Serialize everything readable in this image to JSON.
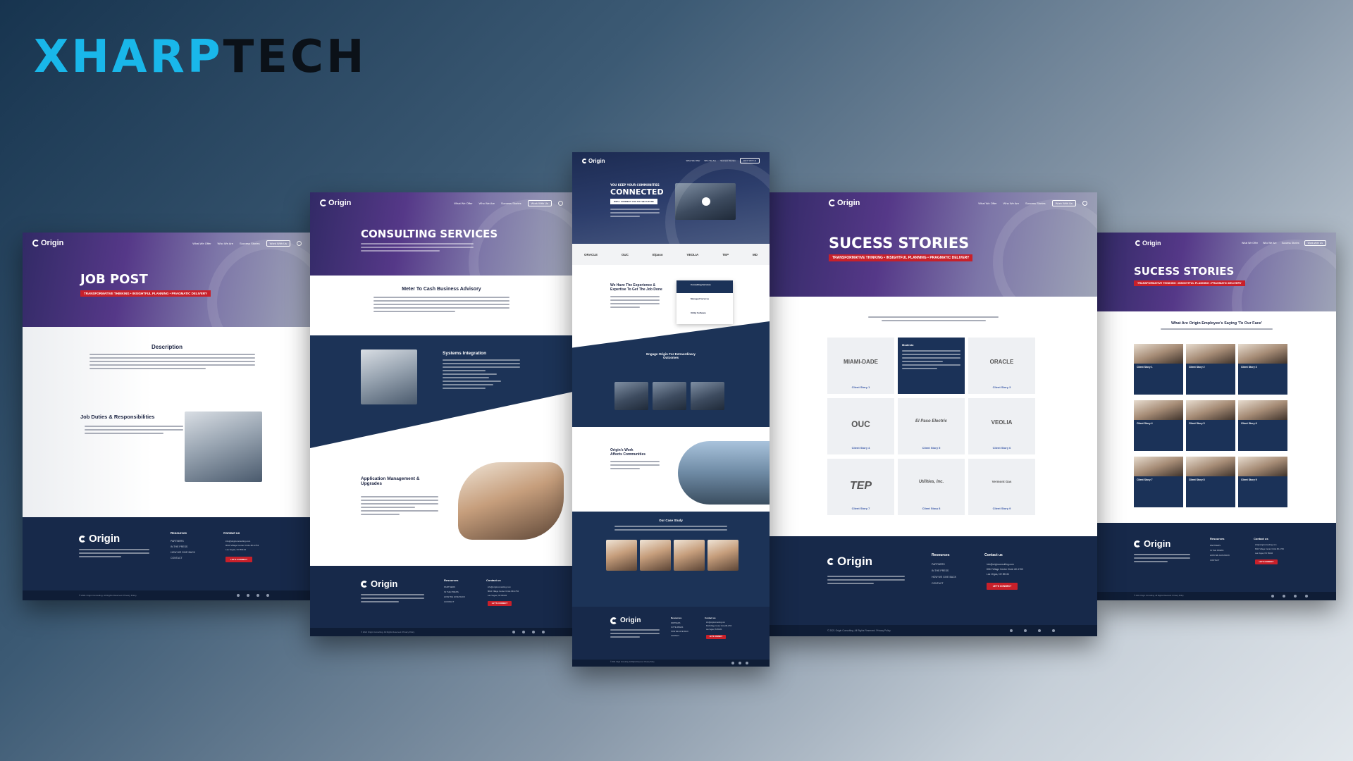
{
  "brand": {
    "part1": "XHARP",
    "part2": "TECH"
  },
  "site": {
    "logo": "Origin",
    "nav": [
      "What We Offer",
      "Who We Are",
      "Success Stories",
      "Work With Us"
    ],
    "footer": {
      "resources_heading": "Resources",
      "resources": [
        "PARTNERS",
        "IN THE PRESS",
        "HOW WE GIVE BACK",
        "CONTACT"
      ],
      "contact_heading": "Contact us",
      "email": "info@originconsulting.com",
      "address1": "8010 Village Center Circle #D-1763",
      "address2": "Las Vegas, NV 89134",
      "cta": "LET'S CONNECT",
      "copyright": "© 2021 Origin Consulting. All Rights Reserved. Privacy Policy"
    }
  },
  "job_post": {
    "title": "JOB POST",
    "tagline": "TRANSFORMATIVE THINKING • INSIGHTFUL PLANNING • PRAGMATIC DELIVERY",
    "desc_heading": "Description",
    "duties_heading": "Job Duties & Responsibilities"
  },
  "consulting": {
    "title": "CONSULTING SERVICES",
    "advisory_heading": "Meter To Cash Business Advisory",
    "integration_heading": "Systems Integration",
    "app_heading1": "Application Management &",
    "app_heading2": "Upgrades"
  },
  "home": {
    "hero_small": "YOU KEEP YOUR COMMUNITIES",
    "hero_big": "CONNECTED",
    "hero_tag": "WE'LL CONNECT YOU TO THE FUTURE",
    "client_logos": [
      "ORACLE",
      "OUC",
      "Elpaso",
      "VEOLIA",
      "TEP",
      "MD"
    ],
    "exp_heading1": "We Have The Experience &",
    "exp_heading2": "Expertise To Get The Job Done",
    "services": [
      "Consulting Services",
      "Managed Services",
      "Utility Software"
    ],
    "engage_heading1": "Engage Origin For Extraordinary",
    "engage_heading2": "Outcomes",
    "work_heading1": "Origin's Work",
    "work_heading2": "Affects Communities",
    "case_heading": "Our Case Study"
  },
  "stories": {
    "title": "SUCESS STORIES",
    "tagline": "TRANSFORMATIVE THINKING • INSIGHTFUL PLANNING • PRAGMATIC DELIVERY",
    "clients": [
      {
        "name": "MIAMI-DADE",
        "label": "Client Story 1"
      },
      {
        "name": "Modesto",
        "label": "Client Story 2"
      },
      {
        "name": "ORACLE",
        "label": "Client Story 3"
      },
      {
        "name": "OUC",
        "label": "Client Story 4"
      },
      {
        "name": "El Paso Electric",
        "label": "Client Story 5"
      },
      {
        "name": "VEOLIA",
        "label": "Client Story 6"
      },
      {
        "name": "TEP",
        "label": "Client Story 7"
      },
      {
        "name": "Utilities, Inc.",
        "label": "Client Story 8"
      },
      {
        "name": "Vermont Gas",
        "label": "Client Story 9"
      }
    ]
  },
  "employee": {
    "title": "SUCESS STORIES",
    "tagline": "TRANSFORMATIVE THINKING • INSIGHTFUL PLANNING • PRAGMATIC DELIVERY",
    "heading": "What Are Origin Employee's Saying 'To Our Face'",
    "stories": [
      "Client Story 1",
      "Client Story 2",
      "Client Story 3",
      "Client Story 4",
      "Client Story 5",
      "Client Story 6",
      "Client Story 7",
      "Client Story 8",
      "Client Story 9"
    ]
  }
}
